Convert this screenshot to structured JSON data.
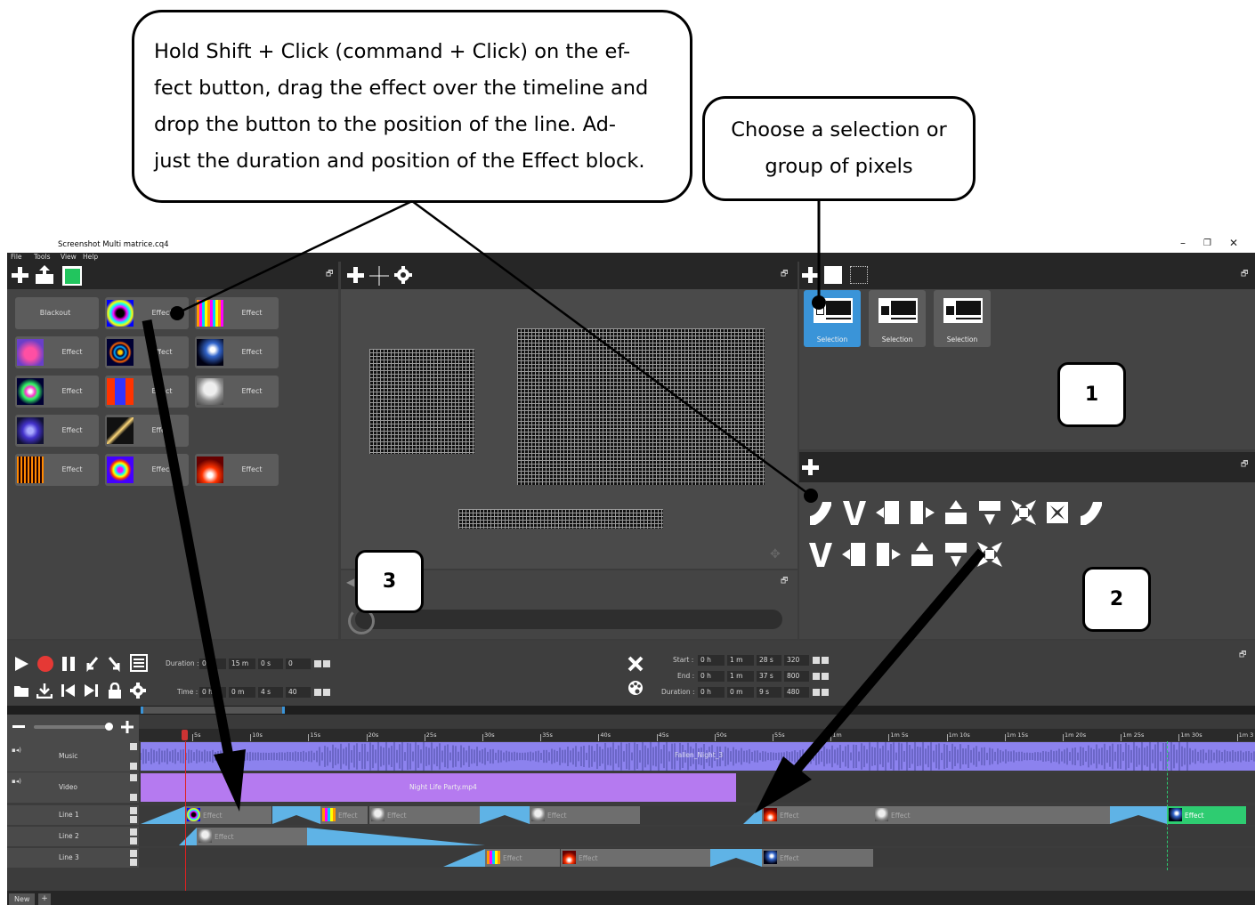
{
  "callouts": {
    "main_lines": [
      "Hold Shift + Click (command + Click) on the ef-",
      "fect button, drag the effect over the timeline and",
      "drop the button to the position of the line.  Ad-",
      "just the duration and position of the Effect block."
    ],
    "selection_lines": [
      "Choose a selection or",
      "group of pixels"
    ],
    "num1": "1",
    "num2": "2",
    "num3": "3"
  },
  "window": {
    "title": "Screenshot Multi matrice.cq4",
    "minimize": "–",
    "restore": "❐",
    "close": "✕"
  },
  "menu": [
    "File",
    "Tools",
    "View",
    "Help"
  ],
  "effects_panel": {
    "blackout_label": "Blackout",
    "effect_label": "Effect",
    "buttons": [
      {
        "label": "Blackout",
        "thumb": "none"
      },
      {
        "label": "Effect",
        "thumb": "tunnel"
      },
      {
        "label": "Effect",
        "thumb": "stripes"
      },
      {
        "label": "Effect",
        "thumb": "heart"
      },
      {
        "label": "Effect",
        "thumb": "rings"
      },
      {
        "label": "Effect",
        "thumb": "dots"
      },
      {
        "label": "Effect",
        "thumb": "splash"
      },
      {
        "label": "Effect",
        "thumb": "butterfly"
      },
      {
        "label": "Effect",
        "thumb": "statue"
      },
      {
        "label": "Effect",
        "thumb": "swirl"
      },
      {
        "label": "Effect",
        "thumb": "beam"
      },
      {
        "label": "Effect",
        "thumb": "equalizer"
      },
      {
        "label": "Effect",
        "thumb": "target"
      },
      {
        "label": "Effect",
        "thumb": "fire"
      }
    ]
  },
  "selections": [
    "Selection",
    "Selection",
    "Selection"
  ],
  "transport": {
    "duration_label": "Duration :",
    "duration": {
      "h": "0 h",
      "m": "15 m",
      "s": "0 s",
      "ms": "0"
    },
    "time_label": "Time :",
    "time": {
      "h": "0 h",
      "m": "0 m",
      "s": "4 s",
      "ms": "40"
    }
  },
  "block_props": {
    "start_label": "Start :",
    "start": {
      "h": "0 h",
      "m": "1 m",
      "s": "28 s",
      "ms": "320"
    },
    "end_label": "End :",
    "end": {
      "h": "0 h",
      "m": "1 m",
      "s": "37 s",
      "ms": "800"
    },
    "duration_label": "Duration :",
    "duration": {
      "h": "0 h",
      "m": "0 m",
      "s": "9 s",
      "ms": "480"
    }
  },
  "timeline": {
    "ticks": [
      "5s",
      "10s",
      "15s",
      "20s",
      "25s",
      "30s",
      "35s",
      "40s",
      "45s",
      "50s",
      "55s",
      "1m",
      "1m 5s",
      "1m 10s",
      "1m 15s",
      "1m 20s",
      "1m 25s",
      "1m 30s",
      "1m 3"
    ],
    "tracks": [
      {
        "name": "Music",
        "clip": "Fallen_Night_3"
      },
      {
        "name": "Video",
        "clip": "Night Life Party.mp4"
      },
      {
        "name": "Line 1"
      },
      {
        "name": "Line 2"
      },
      {
        "name": "Line 3"
      }
    ],
    "block_label": "Effect"
  },
  "tabs": {
    "new": "New",
    "add": "+"
  },
  "colors": {
    "accent": "#3a94d8",
    "transition": "#5fb3e6",
    "music": "#8c82ee",
    "video": "#b57af0",
    "active_block": "#2ecc71",
    "playhead": "#e02020",
    "record": "#e53935"
  }
}
